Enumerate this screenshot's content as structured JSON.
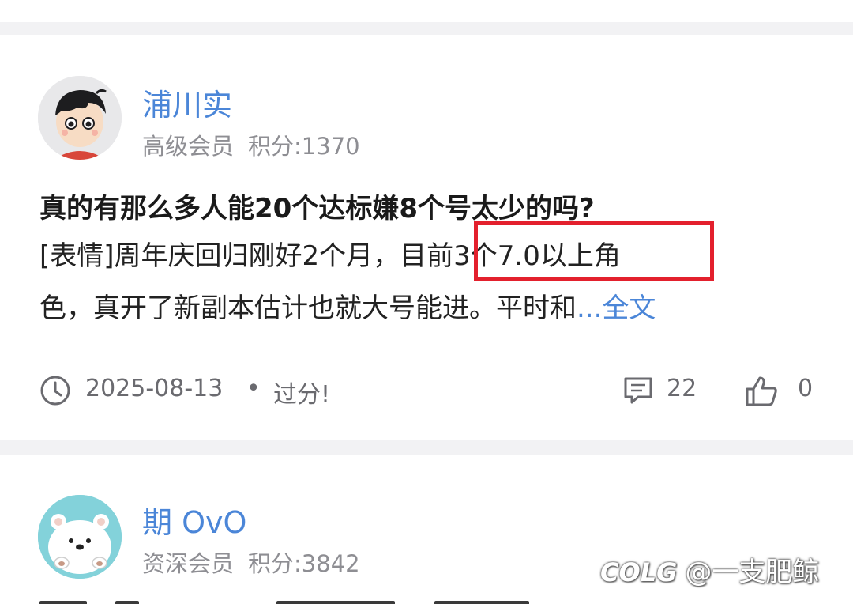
{
  "posts": [
    {
      "username": "浦川实",
      "member_level": "高级会员",
      "points": "积分:1370",
      "title": "真的有那么多人能20个达标嫌8个号太少的吗?",
      "body_line1": "[表情]周年庆回归刚好2个月，目前3个7.0以上角",
      "body_line2": "色，真开了新副本估计也就大号能进。平时和",
      "more_link": "...全文",
      "date": "2025-08-13",
      "separator_dot": "•",
      "tag": "过分!",
      "comment_count": "22",
      "like_count": "0",
      "avatar_icon": "cartoon-boy-avatar"
    },
    {
      "username": "期 OvO",
      "member_level": "资深会员",
      "points": "积分:3842",
      "avatar_icon": "polar-bear-avatar"
    }
  ],
  "watermark": {
    "logo": "COLG",
    "text": "@一支肥鲸"
  },
  "colors": {
    "link_blue": "#4b86d8",
    "highlight_red": "#e3202d",
    "separator_gray": "#f2f2f4"
  },
  "icons": [
    "clock-icon",
    "comment-icon",
    "thumbs-up-icon"
  ]
}
